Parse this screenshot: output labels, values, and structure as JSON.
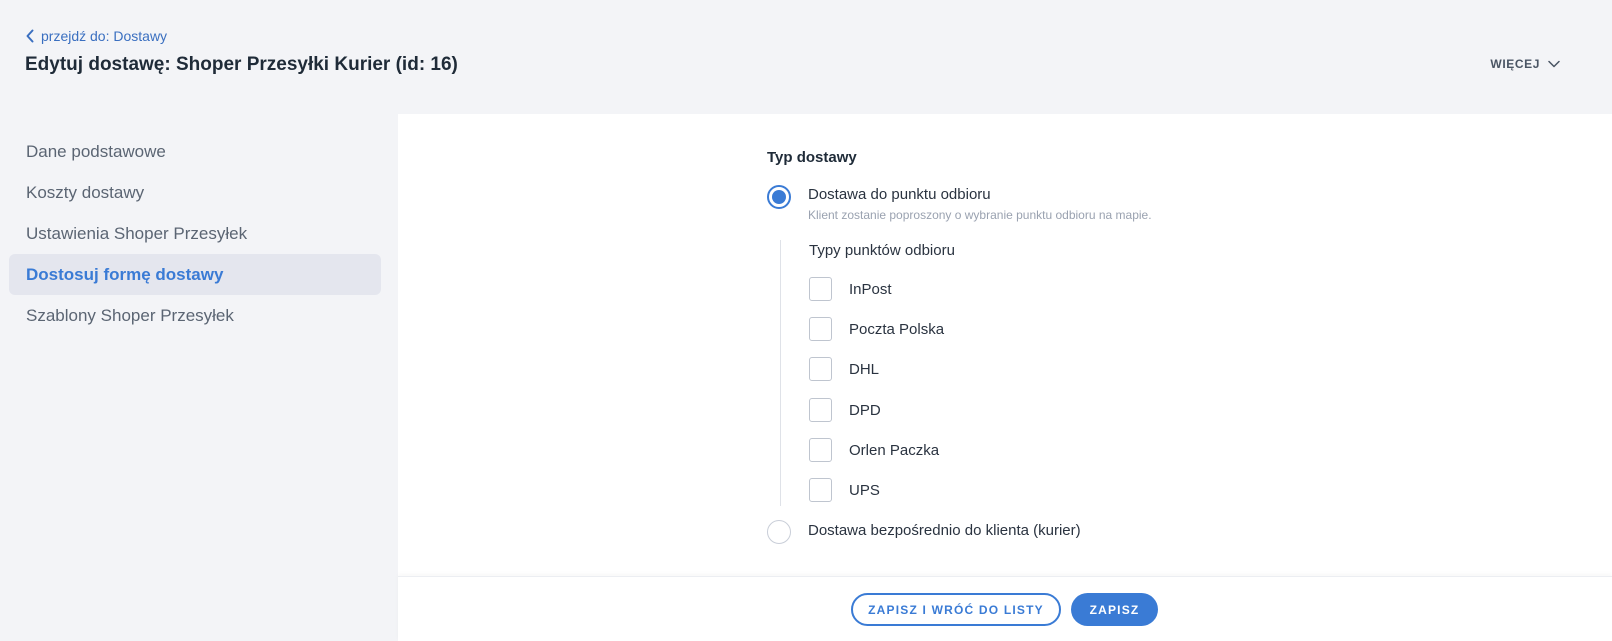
{
  "header": {
    "back_link": "przejdź do: Dostawy",
    "title": "Edytuj dostawę: Shoper Przesyłki Kurier (id: 16)",
    "more_label": "WIĘCEJ"
  },
  "sidebar": {
    "items": [
      {
        "label": "Dane podstawowe",
        "active": false
      },
      {
        "label": "Koszty dostawy",
        "active": false
      },
      {
        "label": "Ustawienia Shoper Przesyłek",
        "active": false
      },
      {
        "label": "Dostosuj formę dostawy",
        "active": true
      },
      {
        "label": "Szablony Shoper Przesyłek",
        "active": false
      }
    ]
  },
  "delivery_type": {
    "title": "Typ dostawy",
    "pickup_option": {
      "label": "Dostawa do punktu odbioru",
      "hint": "Klient zostanie poproszony o wybranie punktu odbioru na mapie.",
      "checked": true
    },
    "pickup_point_types": {
      "title": "Typy punktów odbioru",
      "options": [
        {
          "label": "InPost",
          "checked": false
        },
        {
          "label": "Poczta Polska",
          "checked": false
        },
        {
          "label": "DHL",
          "checked": false
        },
        {
          "label": "DPD",
          "checked": false
        },
        {
          "label": "Orlen Paczka",
          "checked": false
        },
        {
          "label": "UPS",
          "checked": false
        }
      ]
    },
    "courier_option": {
      "label": "Dostawa bezpośrednio do klienta (kurier)",
      "checked": false
    }
  },
  "footer": {
    "save_and_back_label": "ZAPISZ I WRÓĆ DO LISTY",
    "save_label": "ZAPISZ"
  },
  "colors": {
    "accent": "#3a7bd5",
    "background": "#f3f4f7",
    "panel": "#ffffff",
    "active_item_bg": "#e4e6ee"
  }
}
